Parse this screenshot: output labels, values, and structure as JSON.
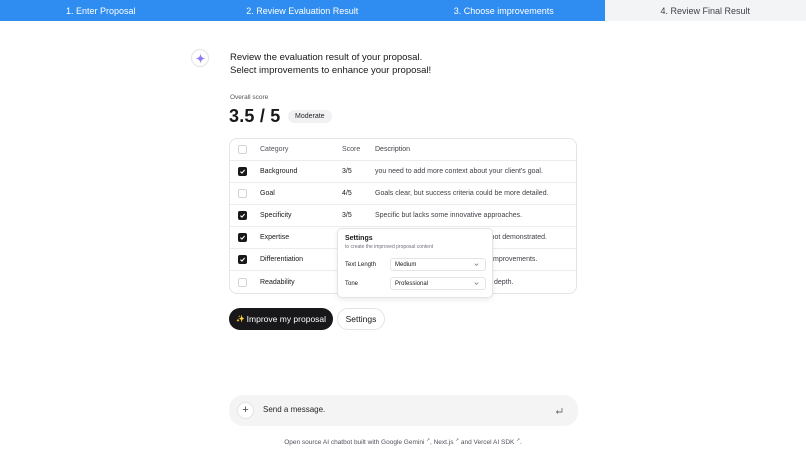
{
  "steps": [
    {
      "label": "1. Enter Proposal"
    },
    {
      "label": "2. Review Evaluation Result"
    },
    {
      "label": "3. Choose improvements"
    },
    {
      "label": "4. Review Final Result"
    }
  ],
  "intro": {
    "line1": "Review the evaluation result of your proposal.",
    "line2": "Select improvements to enhance your proposal!"
  },
  "score": {
    "label": "Overall score",
    "value": "3.5 / 5",
    "badge": "Moderate"
  },
  "table": {
    "headers": {
      "category": "Category",
      "score": "Score",
      "description": "Description"
    },
    "rows": [
      {
        "category": "Background",
        "score": "3/5",
        "description": "you need to add more context about your client's goal.",
        "checked": true
      },
      {
        "category": "Goal",
        "score": "4/5",
        "description": "Goals clear, but success criteria could be more detailed.",
        "checked": false
      },
      {
        "category": "Specificity",
        "score": "3/5",
        "description": "Specific but lacks some innovative approaches.",
        "checked": true
      },
      {
        "category": "Expertise",
        "score": "",
        "description": "lls not demonstrated.",
        "checked": true
      },
      {
        "category": "Differentiation",
        "score": "",
        "description": "mprovements.",
        "checked": true
      },
      {
        "category": "Readability",
        "score": "",
        "description": "depth.",
        "checked": false
      }
    ]
  },
  "settings_popover": {
    "title": "Settings",
    "subtitle": "to create the improved proposal content",
    "text_length_label": "Text Length",
    "text_length_value": "Medium",
    "tone_label": "Tone",
    "tone_value": "Professional"
  },
  "actions": {
    "improve_icon": "✨",
    "improve_label": "Improve my proposal",
    "settings_label": "Settings"
  },
  "composer": {
    "placeholder": "Send a message.",
    "plus_icon": "plus-icon",
    "enter_icon": "enter-icon"
  },
  "footer": {
    "text1": "Open source AI chatbot built with Google Gemini",
    "text2": ", Next.js",
    "text3": " and Vercel AI SDK",
    "text4": ".",
    "arrow": "↗"
  },
  "colors": {
    "step_active_bg": "#2f8cf0",
    "step_final_bg": "#f3f4f6",
    "primary_button": "#18181b",
    "sparkle": "#8b7cf6"
  }
}
